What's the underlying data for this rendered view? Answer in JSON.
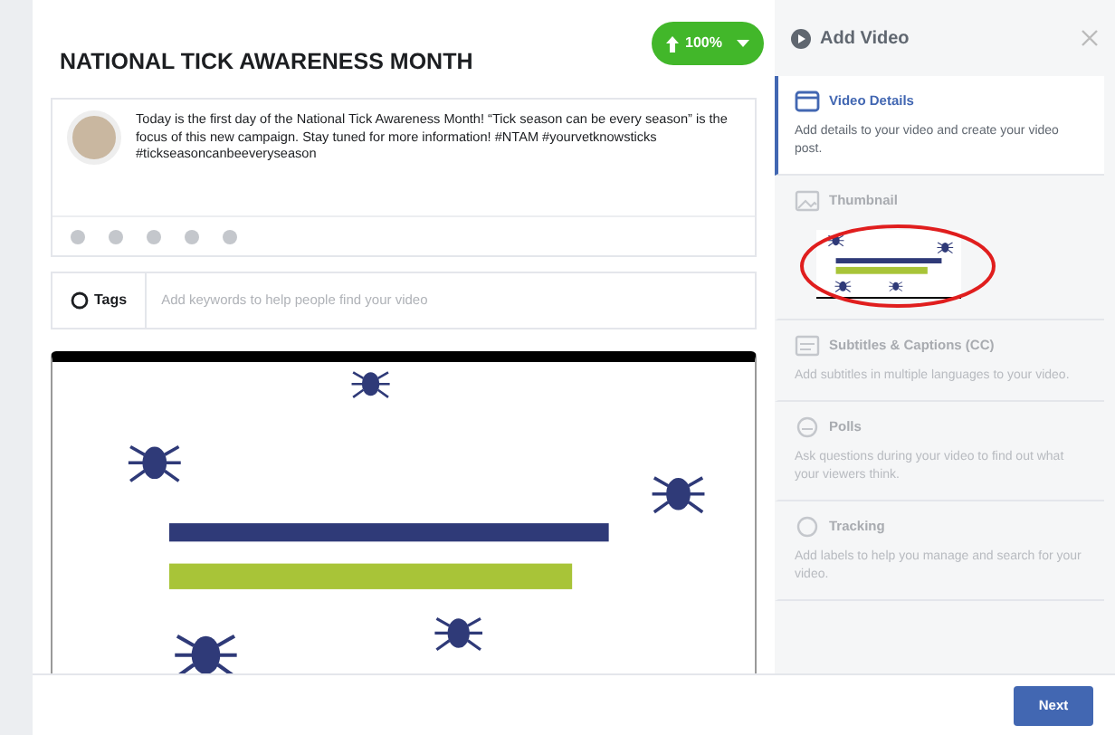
{
  "post": {
    "title": "NATIONAL TICK AWARENESS MONTH",
    "upload_progress": "100%",
    "text": "Today is the first day of the National Tick Awareness Month! “Tick season can be every season” is the focus of this new campaign. Stay tuned for more information! #NTAM #yourvetknowsticks #tickseasoncanbeeveryseason"
  },
  "tags": {
    "label": "Tags",
    "placeholder": "Add keywords to help people find your video"
  },
  "sidebar": {
    "title": "Add Video",
    "sections": [
      {
        "kind": "details",
        "title": "Video Details",
        "description": "Add details to your video and create your video post.",
        "selected": true
      },
      {
        "kind": "thumbnail",
        "title": "Thumbnail",
        "selected": false
      },
      {
        "kind": "captions",
        "title": "Subtitles & Captions (CC)",
        "description": "Add subtitles in multiple languages to your video.",
        "selected": false
      },
      {
        "kind": "polls",
        "title": "Polls",
        "description": "Ask questions during your video to find out what your viewers think.",
        "selected": false
      },
      {
        "kind": "tracking",
        "title": "Tracking",
        "description": "Add labels to help you manage and search for your video.",
        "selected": false
      }
    ]
  },
  "footer": {
    "button": "Next"
  }
}
